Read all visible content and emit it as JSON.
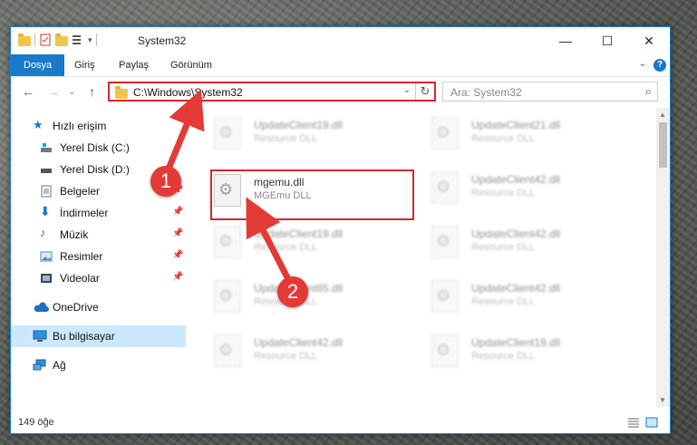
{
  "window": {
    "title": "System32",
    "controls": {
      "minimize": "—",
      "maximize": "☐",
      "close": "✕"
    }
  },
  "ribbon": {
    "tabs": [
      "Dosya",
      "Giriş",
      "Paylaş",
      "Görünüm"
    ],
    "help": "?"
  },
  "navigation": {
    "back": "←",
    "forward": "→",
    "up": "↑",
    "address": "C:\\Windows\\System32",
    "search_placeholder": "Ara: System32"
  },
  "sidebar": {
    "items": [
      {
        "label": "Hızlı erişim",
        "icon": "star-icon"
      },
      {
        "label": "Yerel Disk (C:)",
        "icon": "drive-icon"
      },
      {
        "label": "Yerel Disk (D:)",
        "icon": "drive-icon"
      },
      {
        "label": "Belgeler",
        "icon": "document-icon"
      },
      {
        "label": "İndirmeler",
        "icon": "download-icon"
      },
      {
        "label": "Müzik",
        "icon": "music-icon"
      },
      {
        "label": "Resimler",
        "icon": "pictures-icon"
      },
      {
        "label": "Videolar",
        "icon": "video-icon"
      },
      {
        "label": "OneDrive",
        "icon": "cloud-icon"
      },
      {
        "label": "Bu bilgisayar",
        "icon": "computer-icon"
      },
      {
        "label": "Ağ",
        "icon": "network-icon"
      }
    ]
  },
  "files": {
    "left": [
      {
        "name": "UpdateClient19.dll",
        "type": "Resource DLL"
      },
      {
        "name": "mgemu.dll",
        "type": "MGEmu DLL"
      },
      {
        "name": "UpdateClient19.dll",
        "type": "Resource DLL"
      },
      {
        "name": "UpdateClient65.dll",
        "type": "Resource DLL"
      },
      {
        "name": "UpdateClient42.dll",
        "type": "Resource DLL"
      }
    ],
    "right": [
      {
        "name": "UpdateClient21.dll",
        "type": "Resource DLL"
      },
      {
        "name": "UpdateClient42.dll",
        "type": "Resource DLL"
      },
      {
        "name": "UpdateClient42.dll",
        "type": "Resource DLL"
      },
      {
        "name": "UpdateClient42.dll",
        "type": "Resource DLL"
      },
      {
        "name": "UpdateClient19.dll",
        "type": "Resource DLL"
      }
    ]
  },
  "annotations": {
    "step1": "1",
    "step2": "2"
  },
  "status": {
    "count": "149 öğe"
  },
  "colors": {
    "accent": "#1979ca",
    "highlight": "#d9262b"
  }
}
